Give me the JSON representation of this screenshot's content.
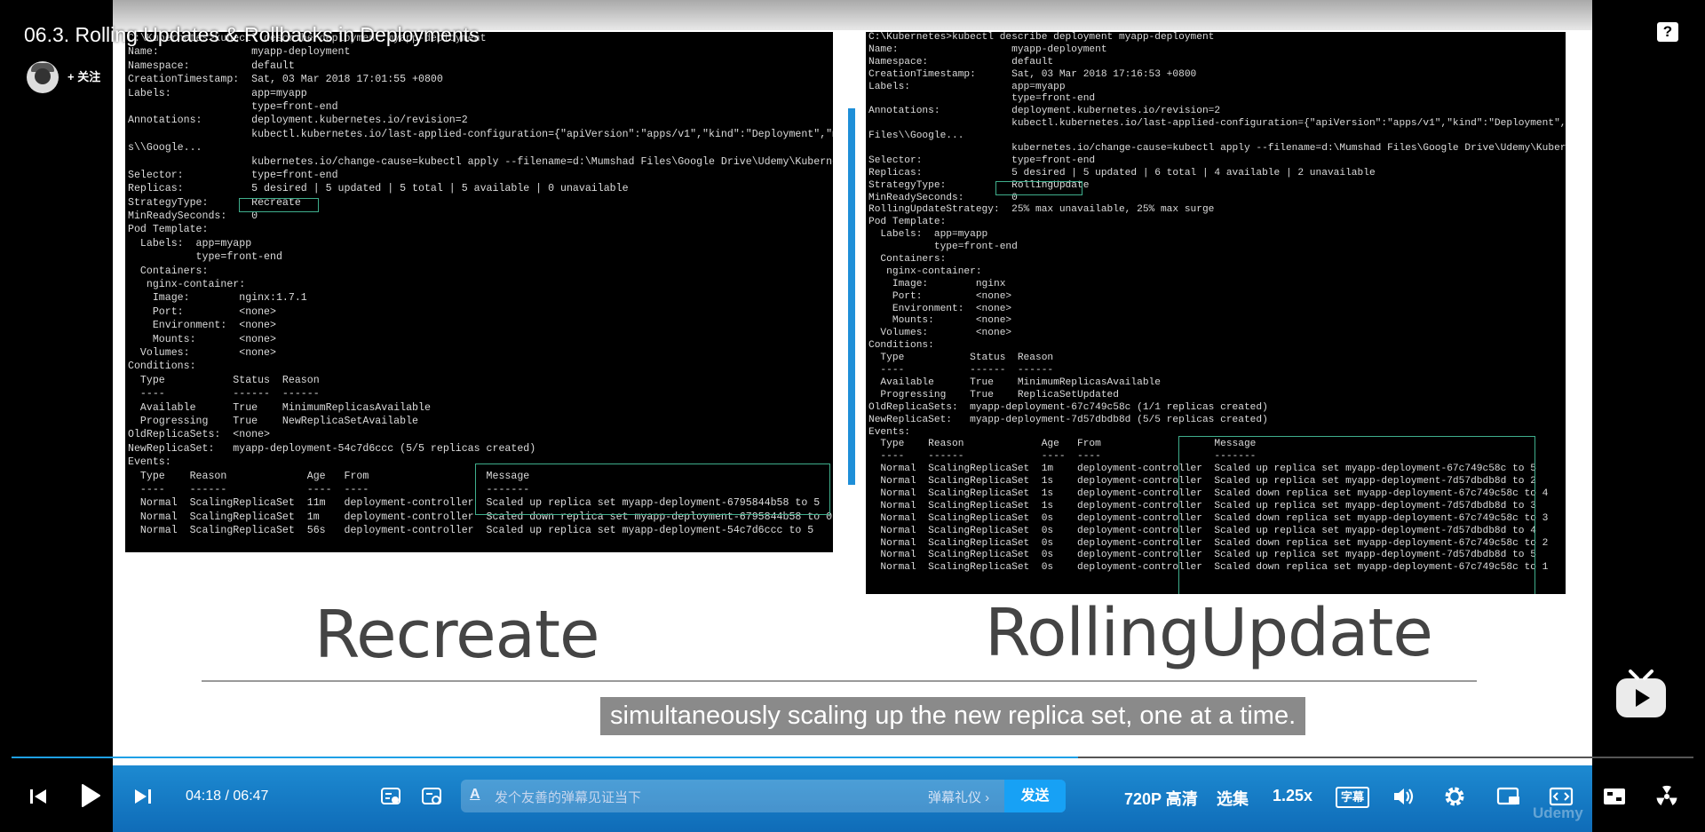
{
  "video_title": "06.3. Rolling Updates & Rollbacks in Deployments",
  "follow_label": "+ 关注",
  "help_icon": "?",
  "subtitle": "simultaneously scaling up the new replica set, one at a time.",
  "captions": {
    "left": "Recreate",
    "right": "RollingUpdate"
  },
  "terminal_left": [
    "C:\\Kubernetes>kubectl describe deployment myapp-deployment",
    "Name:               myapp-deployment",
    "Namespace:          default",
    "CreationTimestamp:  Sat, 03 Mar 2018 17:01:55 +0800",
    "Labels:             app=myapp",
    "                    type=front-end",
    "Annotations:        deployment.kubernetes.io/revision=2",
    "                    kubectl.kubernetes.io/last-applied-configuration={\"apiVersion\":\"apps/v1\",\"kind\":\"Deployment\",\"me",
    "s\\\\Google...",
    "                    kubernetes.io/change-cause=kubectl apply --filename=d:\\Mumshad Files\\Google Drive\\Udemy\\Kubernet",
    "Selector:           type=front-end",
    "Replicas:           5 desired | 5 updated | 5 total | 5 available | 0 unavailable",
    "StrategyType:       Recreate",
    "MinReadySeconds:    0",
    "Pod Template:",
    "  Labels:  app=myapp",
    "           type=front-end",
    "  Containers:",
    "   nginx-container:",
    "    Image:        nginx:1.7.1",
    "    Port:         <none>",
    "    Environment:  <none>",
    "    Mounts:       <none>",
    "  Volumes:        <none>",
    "Conditions:",
    "  Type           Status  Reason",
    "  ----           ------  ------",
    "  Available      True    MinimumReplicasAvailable",
    "  Progressing    True    NewReplicaSetAvailable",
    "OldReplicaSets:  <none>",
    "NewReplicaSet:   myapp-deployment-54c7d6ccc (5/5 replicas created)",
    "Events:",
    "  Type    Reason             Age   From                   Message",
    "  ----    ------             ----  ----                   -------",
    "  Normal  ScalingReplicaSet  11m   deployment-controller  Scaled up replica set myapp-deployment-6795844b58 to 5",
    "  Normal  ScalingReplicaSet  1m    deployment-controller  Scaled down replica set myapp-deployment-6795844b58 to 0",
    "  Normal  ScalingReplicaSet  56s   deployment-controller  Scaled up replica set myapp-deployment-54c7d6ccc to 5"
  ],
  "terminal_right": [
    "C:\\Kubernetes>kubectl describe deployment myapp-deployment",
    "Name:                   myapp-deployment",
    "Namespace:              default",
    "CreationTimestamp:      Sat, 03 Mar 2018 17:16:53 +0800",
    "Labels:                 app=myapp",
    "                        type=front-end",
    "Annotations:            deployment.kubernetes.io/revision=2",
    "                        kubectl.kubernetes.io/last-applied-configuration={\"apiVersion\":\"apps/v1\",\"kind\":\"Deployment\",\"metadata",
    "Files\\\\Google...",
    "                        kubernetes.io/change-cause=kubectl apply --filename=d:\\Mumshad Files\\Google Drive\\Udemy\\Kubernetes\\De",
    "Selector:               type=front-end",
    "Replicas:               5 desired | 5 updated | 6 total | 4 available | 2 unavailable",
    "StrategyType:           RollingUpdate",
    "MinReadySeconds:        0",
    "RollingUpdateStrategy:  25% max unavailable, 25% max surge",
    "Pod Template:",
    "  Labels:  app=myapp",
    "           type=front-end",
    "  Containers:",
    "   nginx-container:",
    "    Image:        nginx",
    "    Port:         <none>",
    "    Environment:  <none>",
    "    Mounts:       <none>",
    "  Volumes:        <none>",
    "Conditions:",
    "  Type           Status  Reason",
    "  ----           ------  ------",
    "  Available      True    MinimumReplicasAvailable",
    "  Progressing    True    ReplicaSetUpdated",
    "OldReplicaSets:  myapp-deployment-67c749c58c (1/1 replicas created)",
    "NewReplicaSet:   myapp-deployment-7d57dbdb8d (5/5 replicas created)",
    "Events:",
    "  Type    Reason             Age   From                   Message",
    "  ----    ------             ----  ----                   -------",
    "  Normal  ScalingReplicaSet  1m    deployment-controller  Scaled up replica set myapp-deployment-67c749c58c to 5",
    "  Normal  ScalingReplicaSet  1s    deployment-controller  Scaled up replica set myapp-deployment-7d57dbdb8d to 2",
    "  Normal  ScalingReplicaSet  1s    deployment-controller  Scaled down replica set myapp-deployment-67c749c58c to 4",
    "  Normal  ScalingReplicaSet  1s    deployment-controller  Scaled up replica set myapp-deployment-7d57dbdb8d to 3",
    "  Normal  ScalingReplicaSet  0s    deployment-controller  Scaled down replica set myapp-deployment-67c749c58c to 3",
    "  Normal  ScalingReplicaSet  0s    deployment-controller  Scaled up replica set myapp-deployment-7d57dbdb8d to 4",
    "  Normal  ScalingReplicaSet  0s    deployment-controller  Scaled down replica set myapp-deployment-67c749c58c to 2",
    "  Normal  ScalingReplicaSet  0s    deployment-controller  Scaled up replica set myapp-deployment-7d57dbdb8d to 5",
    "  Normal  ScalingReplicaSet  0s    deployment-controller  Scaled down replica set myapp-deployment-67c749c58c to 1"
  ],
  "player": {
    "time_current": "04:18",
    "time_separator": "/",
    "time_total": "06:47",
    "progress": 0.634,
    "danmu_icon": "A",
    "danmu_placeholder": "发个友善的弹幕见证当下",
    "danmu_etiquette": "弹幕礼仪 ›",
    "send_label": "发送",
    "quality_label": "720P 高清",
    "episodes_label": "选集",
    "speed_label": "1.25x",
    "subtitle_label": "字幕",
    "watermark": "Udemy"
  },
  "colors": {
    "accent": "#1ea0e6",
    "control_bar": "#1d8ad1",
    "send_button": "#17a1f5",
    "highlight_box": "#3fae8c"
  }
}
